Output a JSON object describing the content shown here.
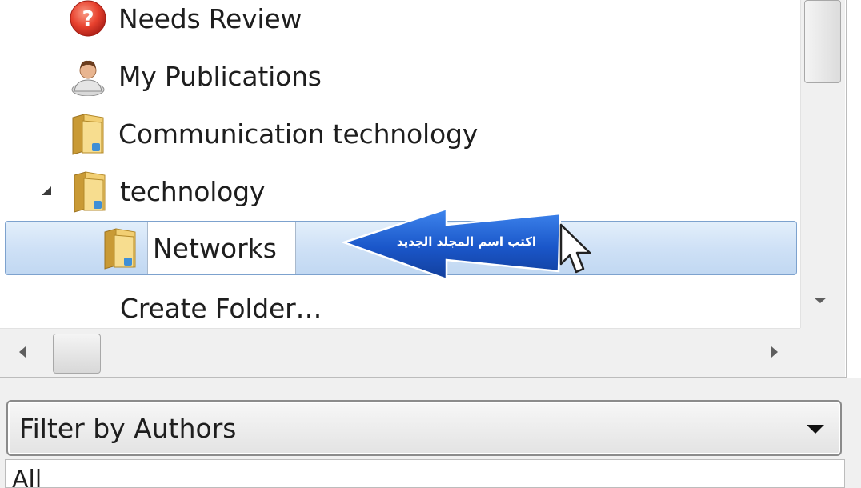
{
  "tree": {
    "items": [
      {
        "label": "Needs Review",
        "icon": "needs-review-icon"
      },
      {
        "label": "My Publications",
        "icon": "person-icon"
      },
      {
        "label": "Communication technology",
        "icon": "folder-icon"
      },
      {
        "label": "technology",
        "icon": "folder-icon",
        "expanded": true
      },
      {
        "label": "Create Folder…",
        "icon": ""
      }
    ],
    "rename": {
      "value": "Networks",
      "icon": "folder-icon"
    }
  },
  "callout": {
    "text": "اكتب اسم المجلد الجديد",
    "color": "#1f5fd4"
  },
  "filter": {
    "label": "Filter by Authors",
    "selected_item": "All"
  },
  "colors": {
    "selection": "#c8ddf4",
    "selection_border": "#7da2ce",
    "needs_review_red": "#e8412e",
    "folder_yellow": "#e8b84a"
  }
}
